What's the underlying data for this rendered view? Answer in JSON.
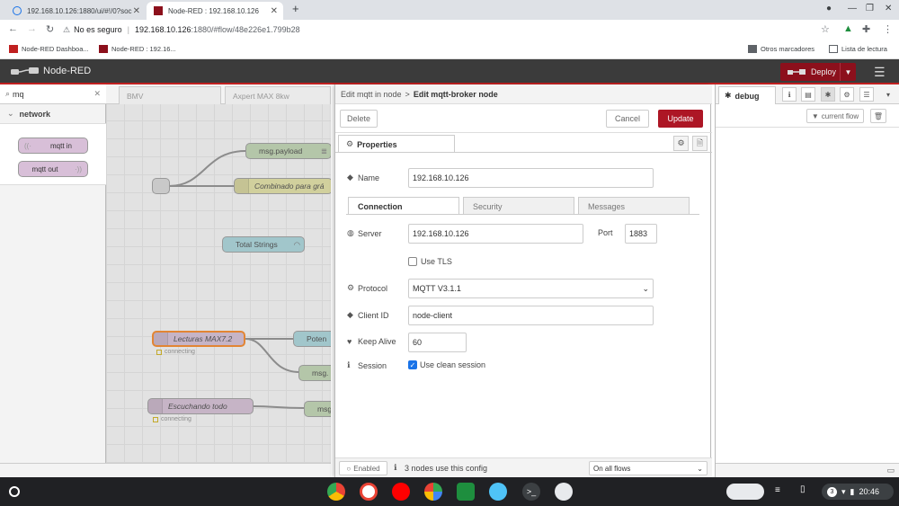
{
  "browser": {
    "tabs": [
      {
        "title": "192.168.10.126:1880/ui/#!/0?soc",
        "active": false
      },
      {
        "title": "Node-RED : 192.168.10.126",
        "active": true
      }
    ],
    "new_tab": "+",
    "address": {
      "security": "No es seguro",
      "host": "192.168.10.126",
      "path": ":1880/#flow/48e226e1.799b28"
    },
    "bookmarks": [
      "Node-RED Dashboa...",
      "Node-RED : 192.16..."
    ],
    "bookmarks_right": [
      "Otros marcadores",
      "Lista de lectura"
    ]
  },
  "header": {
    "app_title": "Node-RED",
    "deploy_label": "Deploy"
  },
  "palette": {
    "search_value": "mq",
    "category": "network",
    "nodes": [
      "mqtt in",
      "mqtt out"
    ]
  },
  "workspace": {
    "tabs": [
      "BMV",
      "Axpert MAX 8kw"
    ],
    "nodes": {
      "msg_payload": "msg.payload",
      "combinado": "Combinado para grá",
      "total_strings": "Total Strings",
      "lecturas": "Lecturas MAX7.2",
      "poten": "Poten",
      "msg2": "msg.",
      "escuchando": "Escuchando todo",
      "msg3": "msg"
    },
    "status_connecting": "connecting"
  },
  "tray": {
    "breadcrumb_parent": "Edit mqtt in node",
    "breadcrumb_sep": ">",
    "breadcrumb_current": "Edit mqtt-broker node",
    "delete_label": "Delete",
    "cancel_label": "Cancel",
    "update_label": "Update",
    "properties_tab": "Properties",
    "name_label": "Name",
    "name_value": "192.168.10.126",
    "tabs": [
      "Connection",
      "Security",
      "Messages"
    ],
    "server_label": "Server",
    "server_value": "192.168.10.126",
    "port_label": "Port",
    "port_value": "1883",
    "use_tls_label": "Use TLS",
    "protocol_label": "Protocol",
    "protocol_value": "MQTT V3.1.1",
    "client_id_label": "Client ID",
    "client_id_value": "node-client",
    "keep_alive_label": "Keep Alive",
    "keep_alive_value": "60",
    "session_label": "Session",
    "clean_session_label": "Use clean session",
    "clean_session_checked": true,
    "enabled_label": "Enabled",
    "usage_text": "3 nodes use this config",
    "scope_value": "On all flows"
  },
  "sidebar": {
    "active_tab": "debug",
    "filter_label": "current flow"
  },
  "shelf": {
    "time": "20:46",
    "notif_count": "3"
  },
  "colors": {
    "deploy": "#8c101c",
    "update": "#ad1625",
    "header": "#3b3b3b",
    "mqtt_node": "#d8bfd8",
    "ui_node": "#a6d8e0",
    "function_node": "#c0d8b0"
  }
}
